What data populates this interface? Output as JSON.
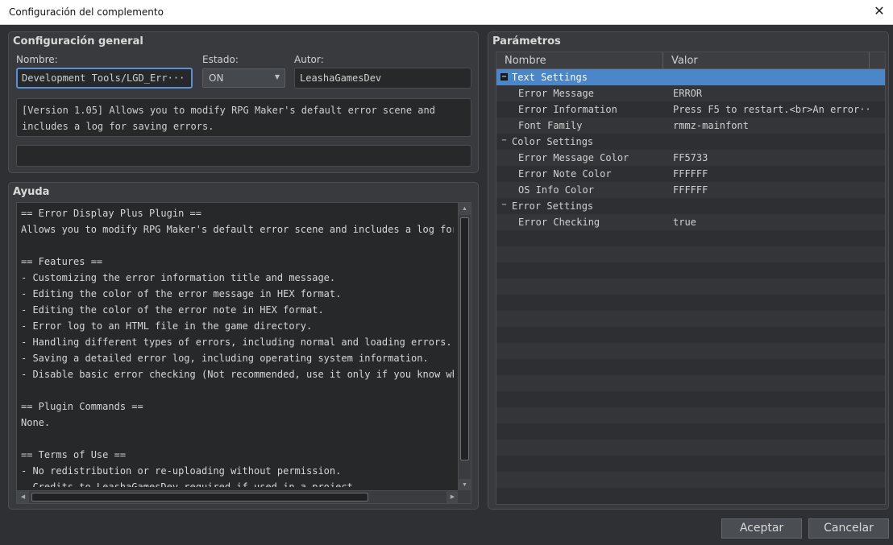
{
  "window": {
    "title": "Configuración del complemento",
    "close_icon": "✕"
  },
  "general": {
    "title": "Configuración general",
    "name_label": "Nombre:",
    "name_value": "Development Tools/LGD_Err··· ···",
    "status_label": "Estado:",
    "status_value": "ON",
    "author_label": "Autor:",
    "author_value": "LeashaGamesDev",
    "description": "[Version 1.05] Allows you to modify RPG Maker's default error scene and\nincludes a log for saving errors.",
    "extra_value": ""
  },
  "help": {
    "title": "Ayuda",
    "lines": [
      "== Error Display Plus Plugin ==",
      "Allows you to modify RPG Maker's default error scene and includes a log for s",
      "",
      "== Features ==",
      "- Customizing the error information title and message.",
      "- Editing the color of the error message in HEX format.",
      "- Editing the color of the error note in HEX format.",
      "- Error log to an HTML file in the game directory.",
      "- Handling different types of errors, including normal and loading errors.",
      "- Saving a detailed error log, including operating system information.",
      "- Disable basic error checking (Not recommended, use it only if you know what",
      "",
      "== Plugin Commands ==",
      "None.",
      "",
      "== Terms of Use ==",
      "- No redistribution or re-uploading without permission.",
      "- Credits to LeashaGamesDev required if used in a project."
    ]
  },
  "params": {
    "title": "Parámetros",
    "col_name": "Nombre",
    "col_value": "Valor",
    "rows": [
      {
        "name": "Text Settings",
        "value": "",
        "group": true,
        "selected": true
      },
      {
        "name": "Error Message",
        "value": "ERROR"
      },
      {
        "name": "Error Information",
        "value": "Press F5 to restart.<br>An error···"
      },
      {
        "name": "Font Family",
        "value": "rmmz-mainfont"
      },
      {
        "name": "Color Settings",
        "value": "",
        "group": true
      },
      {
        "name": "Error Message Color",
        "value": "FF5733"
      },
      {
        "name": "Error Note Color",
        "value": "FFFFFF"
      },
      {
        "name": "OS Info Color",
        "value": "FFFFFF"
      },
      {
        "name": "Error Settings",
        "value": "",
        "group": true
      },
      {
        "name": "Error Checking",
        "value": "true"
      }
    ],
    "empty_row_count": 17
  },
  "buttons": {
    "ok": "Aceptar",
    "cancel": "Cancelar"
  },
  "colors": {
    "background": "#2e3033",
    "panel": "#383a3d",
    "selection": "#4a86c8",
    "focus_border": "#5b8fd8"
  }
}
